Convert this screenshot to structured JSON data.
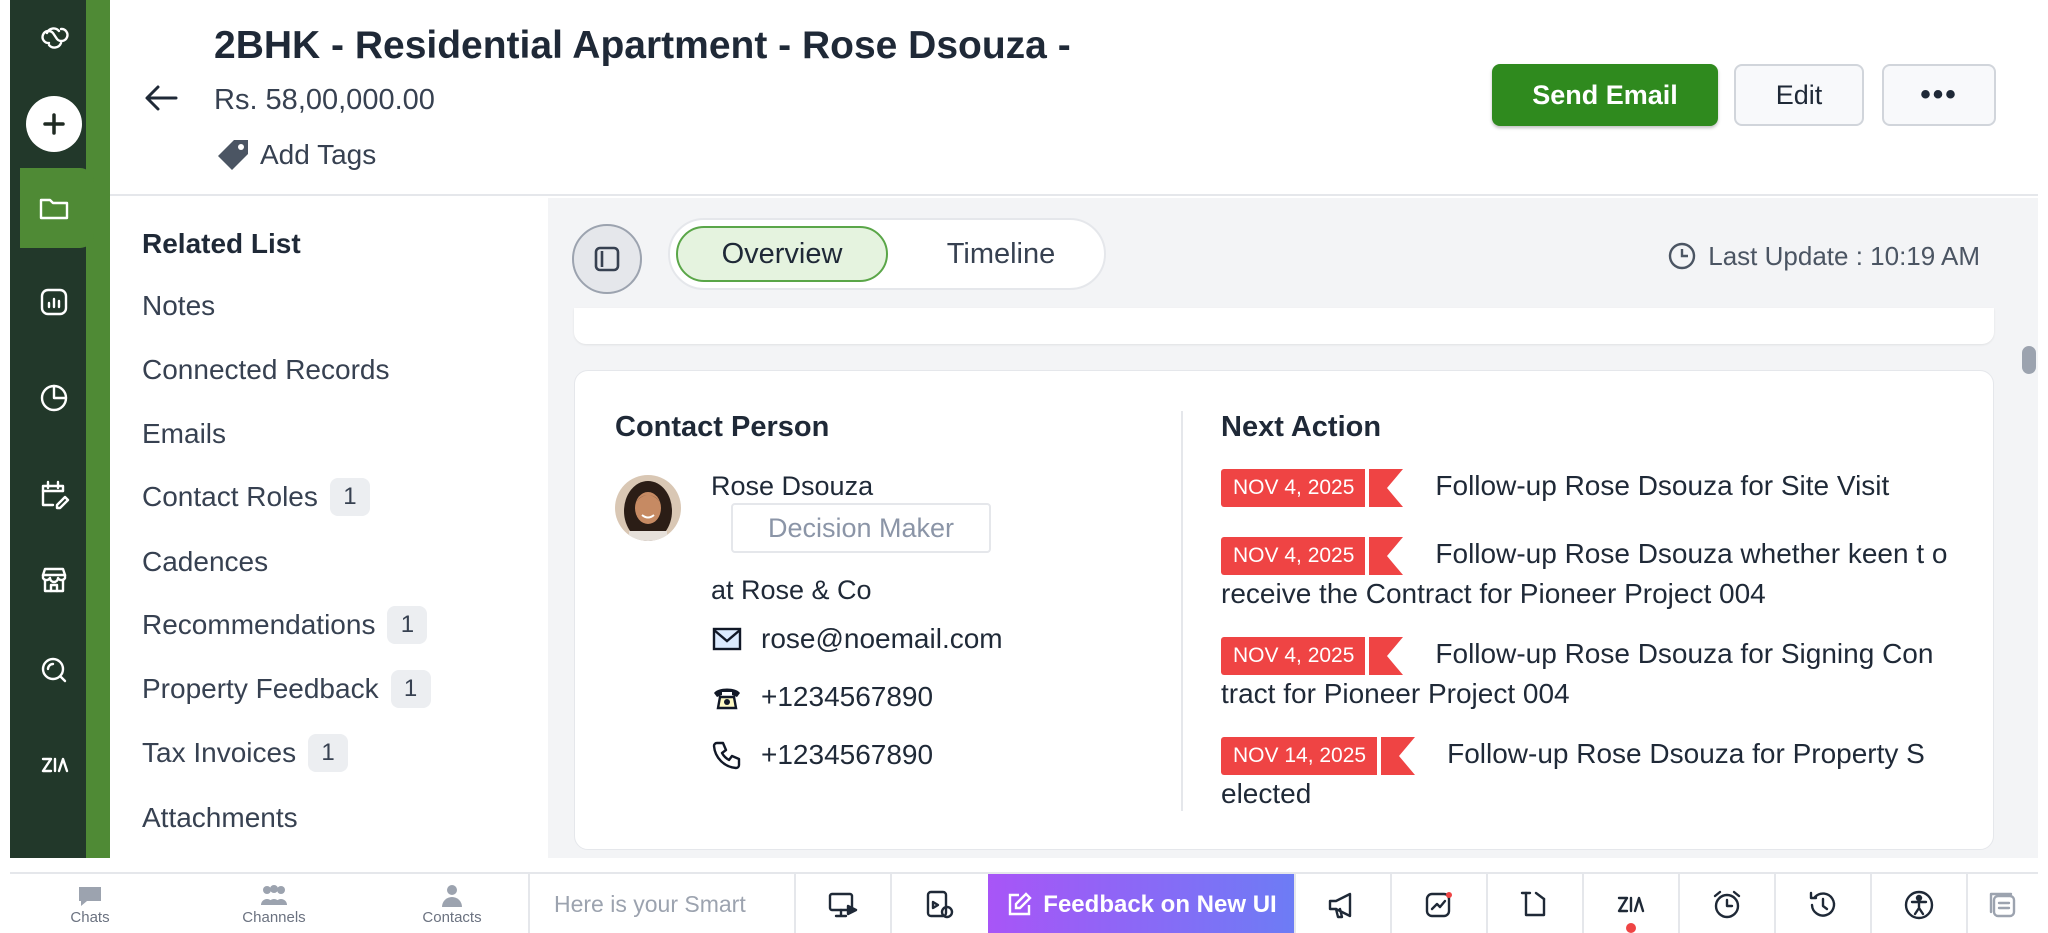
{
  "header": {
    "title": "2BHK - Residential Apartment - Rose Dsouza -",
    "amount": "Rs. 58,00,000.00",
    "add_tags": "Add Tags",
    "send_email": "Send Email",
    "edit": "Edit",
    "more": "•••"
  },
  "related": {
    "title": "Related List",
    "items": [
      {
        "label": "Notes",
        "count": ""
      },
      {
        "label": "Connected Records",
        "count": ""
      },
      {
        "label": "Emails",
        "count": ""
      },
      {
        "label": "Contact Roles",
        "count": "1"
      },
      {
        "label": "Cadences",
        "count": ""
      },
      {
        "label": "Recommendations",
        "count": "1"
      },
      {
        "label": "Property Feedback",
        "count": "1"
      },
      {
        "label": "Tax Invoices",
        "count": "1"
      },
      {
        "label": "Attachments",
        "count": ""
      }
    ]
  },
  "tabs": {
    "overview": "Overview",
    "timeline": "Timeline",
    "last_update": "Last Update : 10:19 AM"
  },
  "contact": {
    "title": "Contact Person",
    "name": "Rose Dsouza",
    "role": "Decision Maker",
    "company": "at Rose & Co",
    "email": "rose@noemail.com",
    "phone": "+1234567890",
    "mobile": "+1234567890"
  },
  "next_action": {
    "title": "Next Action",
    "items": [
      {
        "date": "NOV 4, 2025",
        "text": "Follow-up Rose Dsouza for Site Visit"
      },
      {
        "date": "NOV 4, 2025",
        "text": "Follow-up Rose Dsouza whether keen t o receive the Contract for Pioneer Project 004"
      },
      {
        "date": "NOV 4, 2025",
        "text": "Follow-up Rose Dsouza for Signing Con tract for Pioneer Project 004"
      },
      {
        "date": "NOV 14, 2025",
        "text": "Follow-up Rose Dsouza for Property S elected"
      }
    ]
  },
  "bottom": {
    "chats": "Chats",
    "channels": "Channels",
    "contacts": "Contacts",
    "smart_placeholder": "Here is your Smart",
    "feedback": "Feedback on New UI"
  },
  "colors": {
    "primary_green": "#2f8a1e",
    "rail_dark": "#22382a",
    "rail_green": "#4f8a35",
    "date_red": "#ef4444"
  },
  "icons": [
    "cloud-logo-icon",
    "plus-icon",
    "folder-icon",
    "report-icon",
    "pie-chart-icon",
    "calendar-edit-icon",
    "store-icon",
    "search-icon",
    "zia-icon",
    "tag-icon",
    "back-arrow-icon",
    "panel-toggle-icon",
    "clock-icon",
    "mail-icon",
    "telephone-icon",
    "phone-icon"
  ]
}
